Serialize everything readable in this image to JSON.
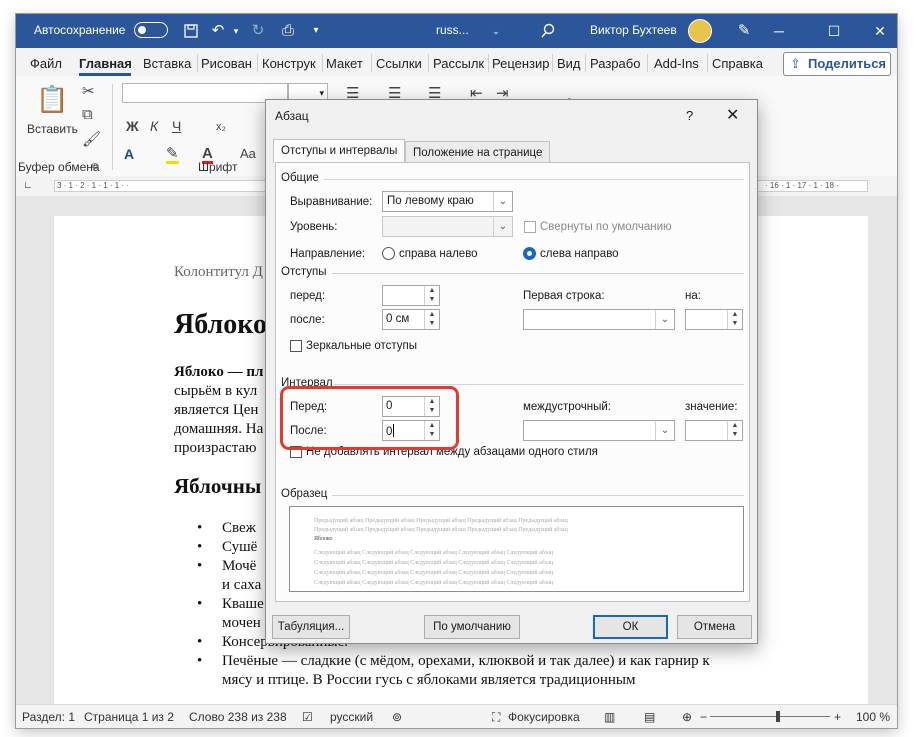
{
  "titlebar": {
    "autosave_label": "Автосохранение",
    "autosave_state": "Откл.",
    "doc_name": "russ...",
    "user_name": "Виктор Бухтеев",
    "icons": [
      "save-icon",
      "undo-icon",
      "redo-icon",
      "print-icon",
      "dropdown-icon",
      "search-icon",
      "minimize-icon",
      "restore-icon",
      "close-icon"
    ]
  },
  "menu": {
    "tabs": [
      "Файл",
      "Главная",
      "Вставка",
      "Рисован",
      "Конструк",
      "Макет",
      "Ссылки",
      "Рассылк",
      "Рецензир",
      "Вид",
      "Разрабо",
      "Add-Ins",
      "Справка"
    ],
    "active_tab": "Главная",
    "share_label": "Поделиться"
  },
  "ribbon": {
    "paste_label": "Вставить",
    "clipboard_group": "Буфер обмена",
    "font_group": "Шрифт",
    "bold": "Ж",
    "italic": "К",
    "underline": "Ч",
    "font_size": "",
    "change_case": "Aa"
  },
  "ruler": {
    "left_marks": "3 · 1 · 2 · 1 · 1 · 1 · ·",
    "right_marks": "· 16 · 1 · 17 · 1 · 18 ·"
  },
  "document": {
    "header_text": "Колонтитул Д",
    "title": "Яблоко",
    "para_lines": [
      "Яблоко — пл",
      "сырьём в кул",
      "является Цен",
      "домашняя. На",
      "произрастаю"
    ],
    "section_title": "Яблочны",
    "list_items": [
      "Свеж",
      "Сушё",
      "Мочё",
      "и саха",
      "Кваше",
      "мочен",
      "Консервированные.",
      "Печёные — сладкие (с мёдом, орехами, клюквой и так далее) и как гарнир к",
      "мясу и птице. В России гусь с яблоками является традиционным"
    ]
  },
  "dialog": {
    "title": "Абзац",
    "help": "?",
    "close": "✕",
    "tabs": [
      "Отступы и интервалы",
      "Положение на странице"
    ],
    "general": {
      "section": "Общие",
      "alignment_label": "Выравнивание:",
      "alignment_value": "По левому краю",
      "level_label": "Уровень:",
      "level_value": "",
      "collapsed_label": "Свернуты по умолчанию",
      "direction_label": "Направление:",
      "rtl_label": "справа налево",
      "ltr_label": "слева направо"
    },
    "indents": {
      "section": "Отступы",
      "before_label": "перед:",
      "before_value": "",
      "after_label": "после:",
      "after_value": "0 см",
      "first_line_label": "Первая строка:",
      "first_line_value": "",
      "by_label": "на:",
      "by_value": "",
      "mirror_label": "Зеркальные отступы"
    },
    "spacing": {
      "section": "Интервал",
      "before_label": "Перед:",
      "before_value": "0",
      "after_label": "После:",
      "after_value": "0",
      "line_label": "междустрочный:",
      "line_value": "",
      "value_label": "значение:",
      "value_value": "",
      "dont_add_label": "Не добавлять интервал между абзацами одного стиля"
    },
    "preview": {
      "section": "Образец",
      "prev_lines": [
        "Предыдущий абзац Предыдущий абзац Предыдущий абзац Предыдущий абзац Предыдущий абзац",
        "Предыдущий абзац Предыдущий абзац Предыдущий абзац Предыдущий абзац Предыдущий абзац"
      ],
      "current": "Яблоко",
      "next_lines": [
        "Следующий абзац Следующий абзац Следующий абзац Следующий абзац Следующий абзац",
        "Следующий абзац Следующий абзац Следующий абзац Следующий абзац Следующий абзац",
        "Следующий абзац Следующий абзац Следующий абзац Следующий абзац Следующий абзац",
        "Следующий абзац Следующий абзац Следующий абзац Следующий абзац Следующий абзац"
      ]
    },
    "buttons": {
      "tabs": "Табуляция...",
      "default": "По умолчанию",
      "ok": "ОК",
      "cancel": "Отмена"
    }
  },
  "status": {
    "section": "Раздел: 1",
    "page": "Страница 1 из 2",
    "words": "Слово 238 из 238",
    "language": "русский",
    "focus": "Фокусировка",
    "zoom": "100 %",
    "zoom_minus": "−",
    "zoom_plus": "+"
  }
}
